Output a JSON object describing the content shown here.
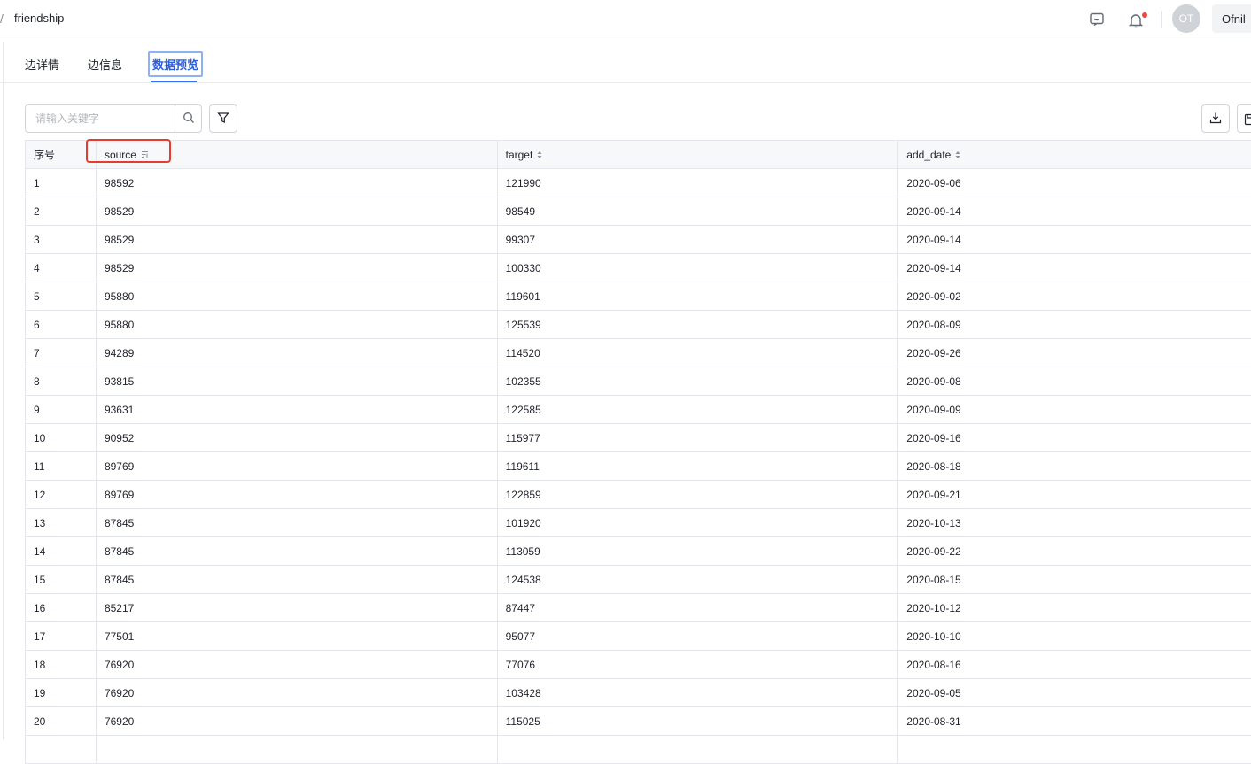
{
  "header": {
    "breadcrumb_sep": "/",
    "title": "friendship",
    "avatar_initials": "OT",
    "user_name": "Ofnil"
  },
  "tabs": [
    {
      "label": "边详情"
    },
    {
      "label": "边信息"
    },
    {
      "label": "数据预览",
      "active": true
    }
  ],
  "toolbar": {
    "search_placeholder": "请输入关键字"
  },
  "table": {
    "columns": [
      {
        "label": "序号"
      },
      {
        "label": "source",
        "sort": "desc"
      },
      {
        "label": "target",
        "sort": "none"
      },
      {
        "label": "add_date",
        "sort": "none"
      }
    ],
    "rows": [
      [
        "1",
        "98592",
        "121990",
        "2020-09-06"
      ],
      [
        "2",
        "98529",
        "98549",
        "2020-09-14"
      ],
      [
        "3",
        "98529",
        "99307",
        "2020-09-14"
      ],
      [
        "4",
        "98529",
        "100330",
        "2020-09-14"
      ],
      [
        "5",
        "95880",
        "119601",
        "2020-09-02"
      ],
      [
        "6",
        "95880",
        "125539",
        "2020-08-09"
      ],
      [
        "7",
        "94289",
        "114520",
        "2020-09-26"
      ],
      [
        "8",
        "93815",
        "102355",
        "2020-09-08"
      ],
      [
        "9",
        "93631",
        "122585",
        "2020-09-09"
      ],
      [
        "10",
        "90952",
        "115977",
        "2020-09-16"
      ],
      [
        "11",
        "89769",
        "119611",
        "2020-08-18"
      ],
      [
        "12",
        "89769",
        "122859",
        "2020-09-21"
      ],
      [
        "13",
        "87845",
        "101920",
        "2020-10-13"
      ],
      [
        "14",
        "87845",
        "113059",
        "2020-09-22"
      ],
      [
        "15",
        "87845",
        "124538",
        "2020-08-15"
      ],
      [
        "16",
        "85217",
        "87447",
        "2020-10-12"
      ],
      [
        "17",
        "77501",
        "95077",
        "2020-10-10"
      ],
      [
        "18",
        "76920",
        "77076",
        "2020-08-16"
      ],
      [
        "19",
        "76920",
        "103428",
        "2020-09-05"
      ],
      [
        "20",
        "76920",
        "115025",
        "2020-08-31"
      ],
      [
        "",
        "",
        "",
        ""
      ]
    ]
  },
  "colors": {
    "accent": "#3370ff",
    "highlight": "#e63b30",
    "notification_dot": "#f5443b"
  },
  "icons": [
    "message-icon",
    "bell-icon",
    "search-icon",
    "filter-icon",
    "download-icon",
    "save-icon",
    "sort-icon"
  ]
}
